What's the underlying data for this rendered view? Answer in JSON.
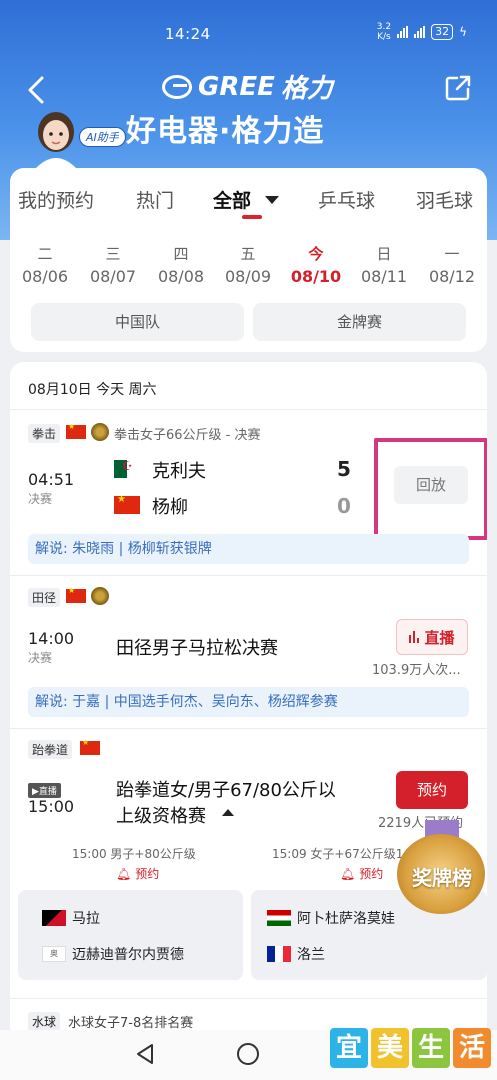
{
  "status": {
    "time": "14:24",
    "net_speed_top": "3.2",
    "net_speed_unit": "K/s",
    "battery": "32"
  },
  "header": {
    "logo_text": "GREE",
    "slogan": "好电器·格力造",
    "ai_badge": "AI助手"
  },
  "tabs": [
    {
      "label": "我的预约"
    },
    {
      "label": "热门"
    },
    {
      "label": "全部"
    },
    {
      "label": "乒乓球"
    },
    {
      "label": "羽毛球"
    }
  ],
  "dates": [
    {
      "weekday": "二",
      "date": "08/06"
    },
    {
      "weekday": "三",
      "date": "08/07"
    },
    {
      "weekday": "四",
      "date": "08/08"
    },
    {
      "weekday": "五",
      "date": "08/09"
    },
    {
      "weekday": "今",
      "date": "08/10"
    },
    {
      "weekday": "日",
      "date": "08/11"
    },
    {
      "weekday": "一",
      "date": "08/12"
    }
  ],
  "filters": {
    "team": "中国队",
    "gold": "金牌赛"
  },
  "list": {
    "date_head": "08月10日 今天 周六",
    "boxing": {
      "tag": "拳击",
      "event": "拳击女子66公斤级 - 决赛",
      "time": "04:51",
      "status": "决赛",
      "p1": "克利夫",
      "s1": "5",
      "p2": "杨柳",
      "s2": "0",
      "button": "回放",
      "commentary": "解说: 朱晓雨 | 杨柳斩获银牌"
    },
    "marathon": {
      "tag": "田径",
      "time": "14:00",
      "status": "决赛",
      "title": "田径男子马拉松决赛",
      "button": "直播",
      "viewers": "103.9万人次...",
      "commentary": "解说: 于嘉 | 中国选手何杰、吴向东、杨绍辉参赛"
    },
    "taekwondo": {
      "tag": "跆拳道",
      "live_tag": "▶直播",
      "time": "15:00",
      "title_line1": "跆拳道女/男子67/80公斤以",
      "title_line2": "上级资格赛",
      "button": "预约",
      "booked": "2219人已预约",
      "sub1_event": "15:00 男子+80公斤级",
      "sub1_book": "预约",
      "sub2_event": "15:09 女子+67公斤级1/8",
      "sub2_book": "预约",
      "sub1_p1": "马拉",
      "sub1_p2": "迈赫迪普尔内贾德",
      "sub1_p2_flag": "奥",
      "sub2_p1": "阿卜杜萨洛莫娃",
      "sub2_p2": "洛兰"
    },
    "waterpolo": {
      "tag": "水球",
      "title": "水球女子7-8名排名赛"
    }
  },
  "medal_button": "奖牌榜",
  "watermark": [
    "宜",
    "美",
    "生",
    "活"
  ],
  "colors": {
    "brand_blue": "#2f6fd6",
    "accent_red": "#d4202a",
    "highlight_pink": "#d4377f"
  }
}
